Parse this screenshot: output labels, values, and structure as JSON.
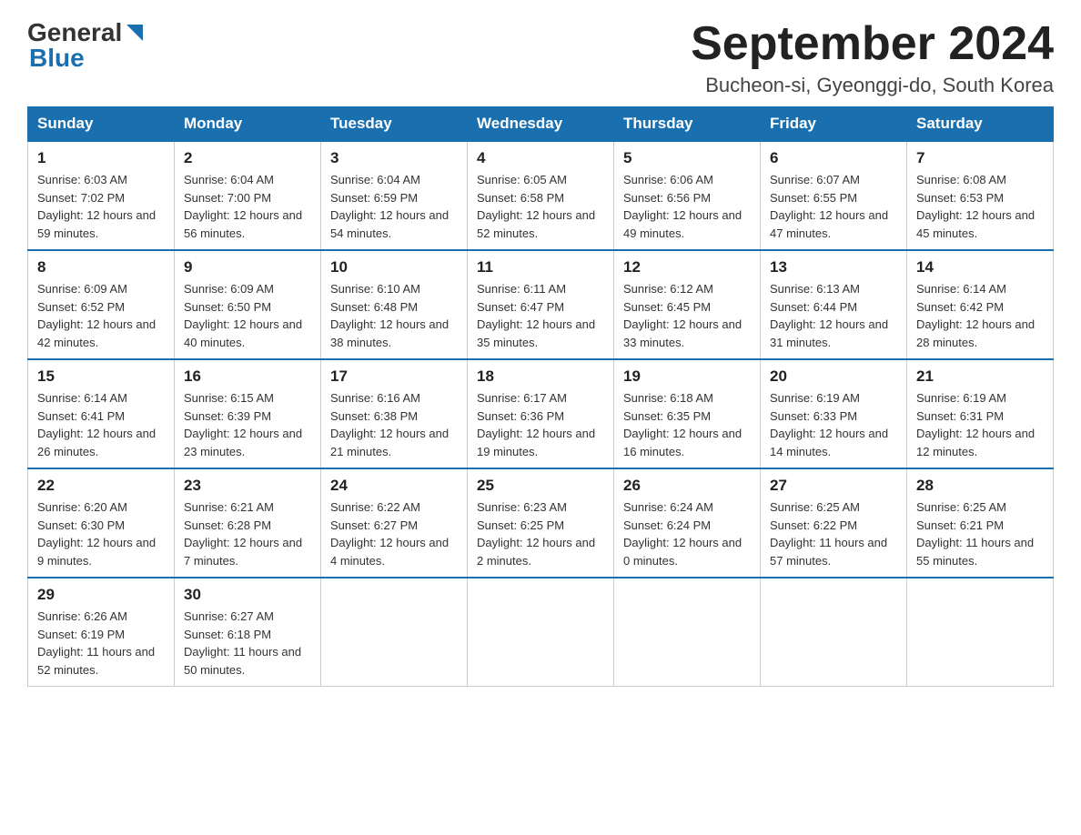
{
  "header": {
    "logo_general": "General",
    "logo_blue": "Blue",
    "month_year": "September 2024",
    "location": "Bucheon-si, Gyeonggi-do, South Korea"
  },
  "days_of_week": [
    "Sunday",
    "Monday",
    "Tuesday",
    "Wednesday",
    "Thursday",
    "Friday",
    "Saturday"
  ],
  "weeks": [
    [
      {
        "day": "1",
        "sunrise": "6:03 AM",
        "sunset": "7:02 PM",
        "daylight": "12 hours and 59 minutes."
      },
      {
        "day": "2",
        "sunrise": "6:04 AM",
        "sunset": "7:00 PM",
        "daylight": "12 hours and 56 minutes."
      },
      {
        "day": "3",
        "sunrise": "6:04 AM",
        "sunset": "6:59 PM",
        "daylight": "12 hours and 54 minutes."
      },
      {
        "day": "4",
        "sunrise": "6:05 AM",
        "sunset": "6:58 PM",
        "daylight": "12 hours and 52 minutes."
      },
      {
        "day": "5",
        "sunrise": "6:06 AM",
        "sunset": "6:56 PM",
        "daylight": "12 hours and 49 minutes."
      },
      {
        "day": "6",
        "sunrise": "6:07 AM",
        "sunset": "6:55 PM",
        "daylight": "12 hours and 47 minutes."
      },
      {
        "day": "7",
        "sunrise": "6:08 AM",
        "sunset": "6:53 PM",
        "daylight": "12 hours and 45 minutes."
      }
    ],
    [
      {
        "day": "8",
        "sunrise": "6:09 AM",
        "sunset": "6:52 PM",
        "daylight": "12 hours and 42 minutes."
      },
      {
        "day": "9",
        "sunrise": "6:09 AM",
        "sunset": "6:50 PM",
        "daylight": "12 hours and 40 minutes."
      },
      {
        "day": "10",
        "sunrise": "6:10 AM",
        "sunset": "6:48 PM",
        "daylight": "12 hours and 38 minutes."
      },
      {
        "day": "11",
        "sunrise": "6:11 AM",
        "sunset": "6:47 PM",
        "daylight": "12 hours and 35 minutes."
      },
      {
        "day": "12",
        "sunrise": "6:12 AM",
        "sunset": "6:45 PM",
        "daylight": "12 hours and 33 minutes."
      },
      {
        "day": "13",
        "sunrise": "6:13 AM",
        "sunset": "6:44 PM",
        "daylight": "12 hours and 31 minutes."
      },
      {
        "day": "14",
        "sunrise": "6:14 AM",
        "sunset": "6:42 PM",
        "daylight": "12 hours and 28 minutes."
      }
    ],
    [
      {
        "day": "15",
        "sunrise": "6:14 AM",
        "sunset": "6:41 PM",
        "daylight": "12 hours and 26 minutes."
      },
      {
        "day": "16",
        "sunrise": "6:15 AM",
        "sunset": "6:39 PM",
        "daylight": "12 hours and 23 minutes."
      },
      {
        "day": "17",
        "sunrise": "6:16 AM",
        "sunset": "6:38 PM",
        "daylight": "12 hours and 21 minutes."
      },
      {
        "day": "18",
        "sunrise": "6:17 AM",
        "sunset": "6:36 PM",
        "daylight": "12 hours and 19 minutes."
      },
      {
        "day": "19",
        "sunrise": "6:18 AM",
        "sunset": "6:35 PM",
        "daylight": "12 hours and 16 minutes."
      },
      {
        "day": "20",
        "sunrise": "6:19 AM",
        "sunset": "6:33 PM",
        "daylight": "12 hours and 14 minutes."
      },
      {
        "day": "21",
        "sunrise": "6:19 AM",
        "sunset": "6:31 PM",
        "daylight": "12 hours and 12 minutes."
      }
    ],
    [
      {
        "day": "22",
        "sunrise": "6:20 AM",
        "sunset": "6:30 PM",
        "daylight": "12 hours and 9 minutes."
      },
      {
        "day": "23",
        "sunrise": "6:21 AM",
        "sunset": "6:28 PM",
        "daylight": "12 hours and 7 minutes."
      },
      {
        "day": "24",
        "sunrise": "6:22 AM",
        "sunset": "6:27 PM",
        "daylight": "12 hours and 4 minutes."
      },
      {
        "day": "25",
        "sunrise": "6:23 AM",
        "sunset": "6:25 PM",
        "daylight": "12 hours and 2 minutes."
      },
      {
        "day": "26",
        "sunrise": "6:24 AM",
        "sunset": "6:24 PM",
        "daylight": "12 hours and 0 minutes."
      },
      {
        "day": "27",
        "sunrise": "6:25 AM",
        "sunset": "6:22 PM",
        "daylight": "11 hours and 57 minutes."
      },
      {
        "day": "28",
        "sunrise": "6:25 AM",
        "sunset": "6:21 PM",
        "daylight": "11 hours and 55 minutes."
      }
    ],
    [
      {
        "day": "29",
        "sunrise": "6:26 AM",
        "sunset": "6:19 PM",
        "daylight": "11 hours and 52 minutes."
      },
      {
        "day": "30",
        "sunrise": "6:27 AM",
        "sunset": "6:18 PM",
        "daylight": "11 hours and 50 minutes."
      },
      null,
      null,
      null,
      null,
      null
    ]
  ]
}
